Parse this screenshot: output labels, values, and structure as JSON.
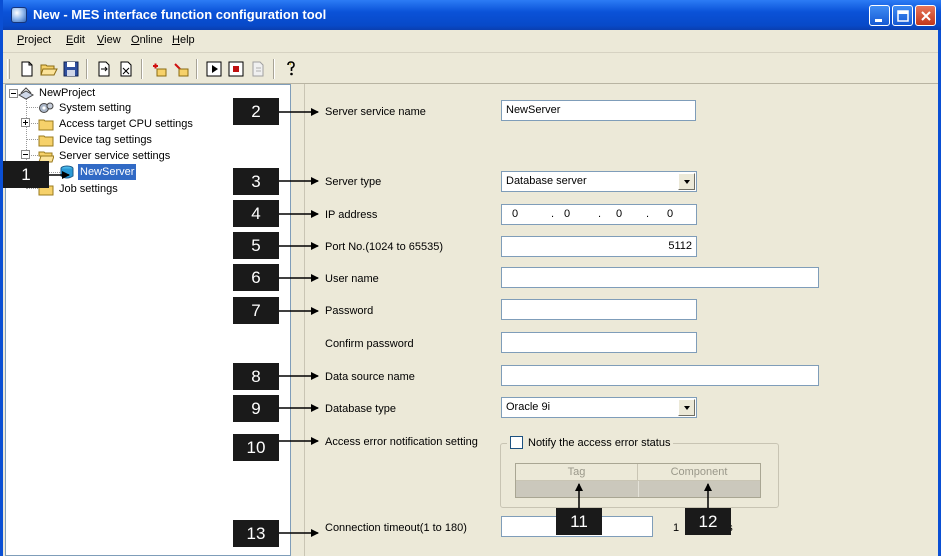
{
  "window": {
    "title": "New - MES interface function configuration tool",
    "accent": "#0a52d8"
  },
  "menu": [
    "Project",
    "Edit",
    "View",
    "Online",
    "Help"
  ],
  "toolbar_icons": [
    "new-file-icon",
    "open-folder-icon",
    "save-icon",
    "import-icon",
    "export-icon",
    "add-item-icon",
    "edit-item-icon",
    "run-icon",
    "stop-icon",
    "online-icon",
    "help-icon"
  ],
  "tree": {
    "root": "NewProject",
    "system": "System setting",
    "access": "Access target CPU settings",
    "device": "Device tag settings",
    "server": "Server service settings",
    "selected": "NewServer",
    "job": "Job settings"
  },
  "form": {
    "server_service_name": {
      "label": "Server service name",
      "value": "NewServer"
    },
    "server_type": {
      "label": "Server type",
      "value": "Database server"
    },
    "ip_address": {
      "label": "IP address",
      "octets": [
        "0",
        "0",
        "0",
        "0"
      ]
    },
    "port": {
      "label": "Port No.(1024 to 65535)",
      "value": "5112"
    },
    "user_name": {
      "label": "User name",
      "value": ""
    },
    "password": {
      "label": "Password",
      "value": ""
    },
    "confirm_password": {
      "label": "Confirm password",
      "value": ""
    },
    "data_source_name": {
      "label": "Data source name",
      "value": ""
    },
    "database_type": {
      "label": "Database type",
      "value": "Oracle 9i"
    },
    "access_error": {
      "label": "Access error notification setting",
      "checkbox_label": "Notify the access error status",
      "columns": [
        "Tag",
        "Component"
      ]
    },
    "connection_timeout": {
      "label": "Connection timeout(1 to 180)",
      "value_partial": "1",
      "unit_partial": "nds"
    }
  },
  "callouts": [
    "1",
    "2",
    "3",
    "4",
    "5",
    "6",
    "7",
    "8",
    "9",
    "10",
    "11",
    "12",
    "13"
  ]
}
